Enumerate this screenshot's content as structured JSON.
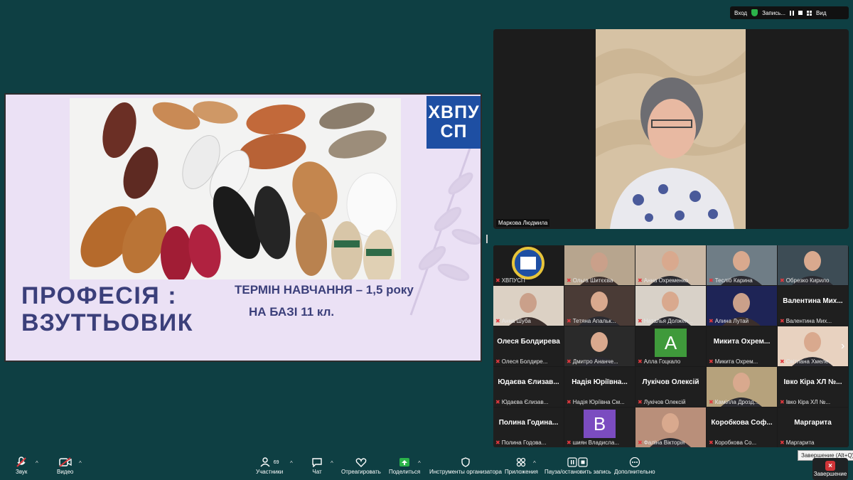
{
  "topbar": {
    "enter_label": "Вход",
    "record_label": "Запись...",
    "view_label": "Вид"
  },
  "slide": {
    "logo_line1": "ХВПУ",
    "logo_line2": "СП",
    "title_line1": "ПРОФЕСІЯ :",
    "title_line2": "ВЗУТТЬОВИК",
    "term": "ТЕРМІН НАВЧАННЯ – 1,5 року",
    "base": "НА БАЗІ  11 кл."
  },
  "speaker": {
    "name": "Маркова Людмила"
  },
  "gallery": {
    "tiles": [
      {
        "big": "",
        "label": "ХВПУСП"
      },
      {
        "big": "",
        "label": "Ольга Шитєєва"
      },
      {
        "big": "",
        "label": "Анна Охременко"
      },
      {
        "big": "",
        "label": "Тесліб Карина"
      },
      {
        "big": "",
        "label": "Обрезко Кирило"
      },
      {
        "big": "",
        "label": "Анна Шуба"
      },
      {
        "big": "",
        "label": "Тетяна Апальк..."
      },
      {
        "big": "",
        "label": "Наталья Должен..."
      },
      {
        "big": "",
        "label": "Алина Лутай"
      },
      {
        "big": "Валентина Мих...",
        "label": "Валентина Мих..."
      },
      {
        "big": "Олеся Болдирева",
        "label": "Олеся Болдире..."
      },
      {
        "big": "",
        "label": "Дмитро Ананче..."
      },
      {
        "big": "",
        "label": "Алла Гоцкало",
        "avatar": "A"
      },
      {
        "big": "Микита Охрем...",
        "label": "Микита Охрем..."
      },
      {
        "big": "",
        "label": "Світлана Хмеле..."
      },
      {
        "big": "Юдаєва Єлизав...",
        "label": "Юдаєва Єлизав..."
      },
      {
        "big": "Надія Юріївна...",
        "label": "Надія Юріївна См..."
      },
      {
        "big": "Лукічов Олексій",
        "label": "Лукічов Олексій"
      },
      {
        "big": "",
        "label": "Камілла Дрозд..."
      },
      {
        "big": "Івко Кіра ХЛ №...",
        "label": "Івко Кіра ХЛ №..."
      },
      {
        "big": "Полина Година...",
        "label": "Полина Годова..."
      },
      {
        "big": "",
        "label": "шиян Владисла...",
        "avatar": "B"
      },
      {
        "big": "",
        "label": "Фаліна Вікторія"
      },
      {
        "big": "Коробкова Соф...",
        "label": "Коробкова Со..."
      },
      {
        "big": "Маргарита",
        "label": "Маргарита"
      }
    ]
  },
  "toolbar": {
    "audio": "Звук",
    "video": "Видео",
    "participants": "Участники",
    "participants_count": "69",
    "chat": "Чат",
    "react": "Отреагировать",
    "share": "Поделиться",
    "host_tools": "Инструменты организатора",
    "apps": "Приложения",
    "pause_record": "Пауза/остановить запись",
    "more": "Дополнительно",
    "end": "Завершение",
    "end_tooltip": "Завершение (Alt+Q)"
  },
  "colors": {
    "background": "#0e3f43",
    "slide_bg": "#ebe1f5",
    "slide_text": "#3b3f7a",
    "logo_bg": "#1e4fa3",
    "end_red": "#d13438"
  }
}
